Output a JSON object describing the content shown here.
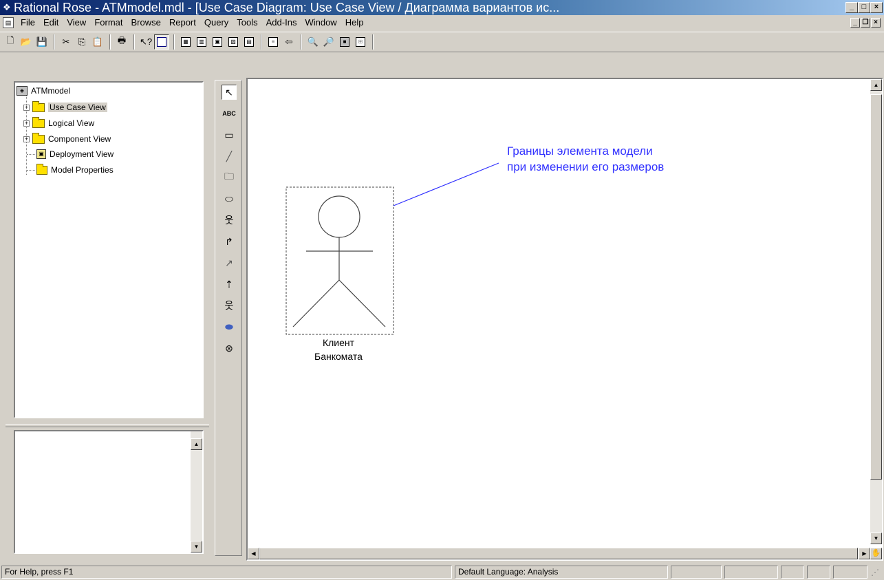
{
  "window": {
    "title": "Rational Rose - ATMmodel.mdl - [Use Case Diagram: Use Case View / Диаграмма вариантов ис...",
    "title_icon": "rose-app-icon",
    "controls": [
      "minimize",
      "maximize",
      "close"
    ]
  },
  "menubar": {
    "items": [
      "File",
      "Edit",
      "View",
      "Format",
      "Browse",
      "Report",
      "Query",
      "Tools",
      "Add-Ins",
      "Window",
      "Help"
    ]
  },
  "toolbar": {
    "buttons": [
      "new-icon",
      "open-icon",
      "save-icon",
      "cut-icon",
      "copy-icon",
      "paste-icon",
      "print-icon",
      "context-help-icon",
      "view-documentation-icon",
      "browse-class-diagram-icon",
      "browse-interaction-diagram-icon",
      "browse-component-diagram-icon",
      "browse-deployment-diagram-icon",
      "browse-parent-icon",
      "browse-previous-diagram-icon",
      "zoom-in-icon",
      "zoom-out-icon",
      "fit-in-window-icon",
      "undo-fit-icon"
    ]
  },
  "browser": {
    "items": [
      {
        "label": "ATMmodel",
        "icon": "model-icon",
        "level": 0
      },
      {
        "label": "Use Case View",
        "icon": "folder-icon",
        "level": 1,
        "expander": "+",
        "selected": true
      },
      {
        "label": "Logical View",
        "icon": "folder-icon",
        "level": 1,
        "expander": "+"
      },
      {
        "label": "Component View",
        "icon": "folder-icon",
        "level": 1,
        "expander": "+"
      },
      {
        "label": "Deployment View",
        "icon": "deployment-icon",
        "level": 1
      },
      {
        "label": "Model Properties",
        "icon": "properties-icon",
        "level": 1
      }
    ]
  },
  "palette": {
    "tools": [
      "selection-arrow-icon",
      "text-box-icon",
      "note-icon",
      "anchor-note-icon",
      "package-icon",
      "use-case-icon",
      "actor-icon",
      "unidirectional-association-icon",
      "dependency-icon",
      "generalization-icon",
      "business-actor-icon",
      "business-use-case-icon",
      "business-worker-icon"
    ],
    "text_tool_label": "ABC"
  },
  "diagram": {
    "annotation_line1": "Границы элемента модели",
    "annotation_line2": "при изменении его размеров",
    "actor_label_line1": "Клиент",
    "actor_label_line2": "Банкомата",
    "annotation_color": "#3333ff"
  },
  "statusbar": {
    "help_text": "For Help, press F1",
    "language_text": "Default Language: Analysis"
  }
}
